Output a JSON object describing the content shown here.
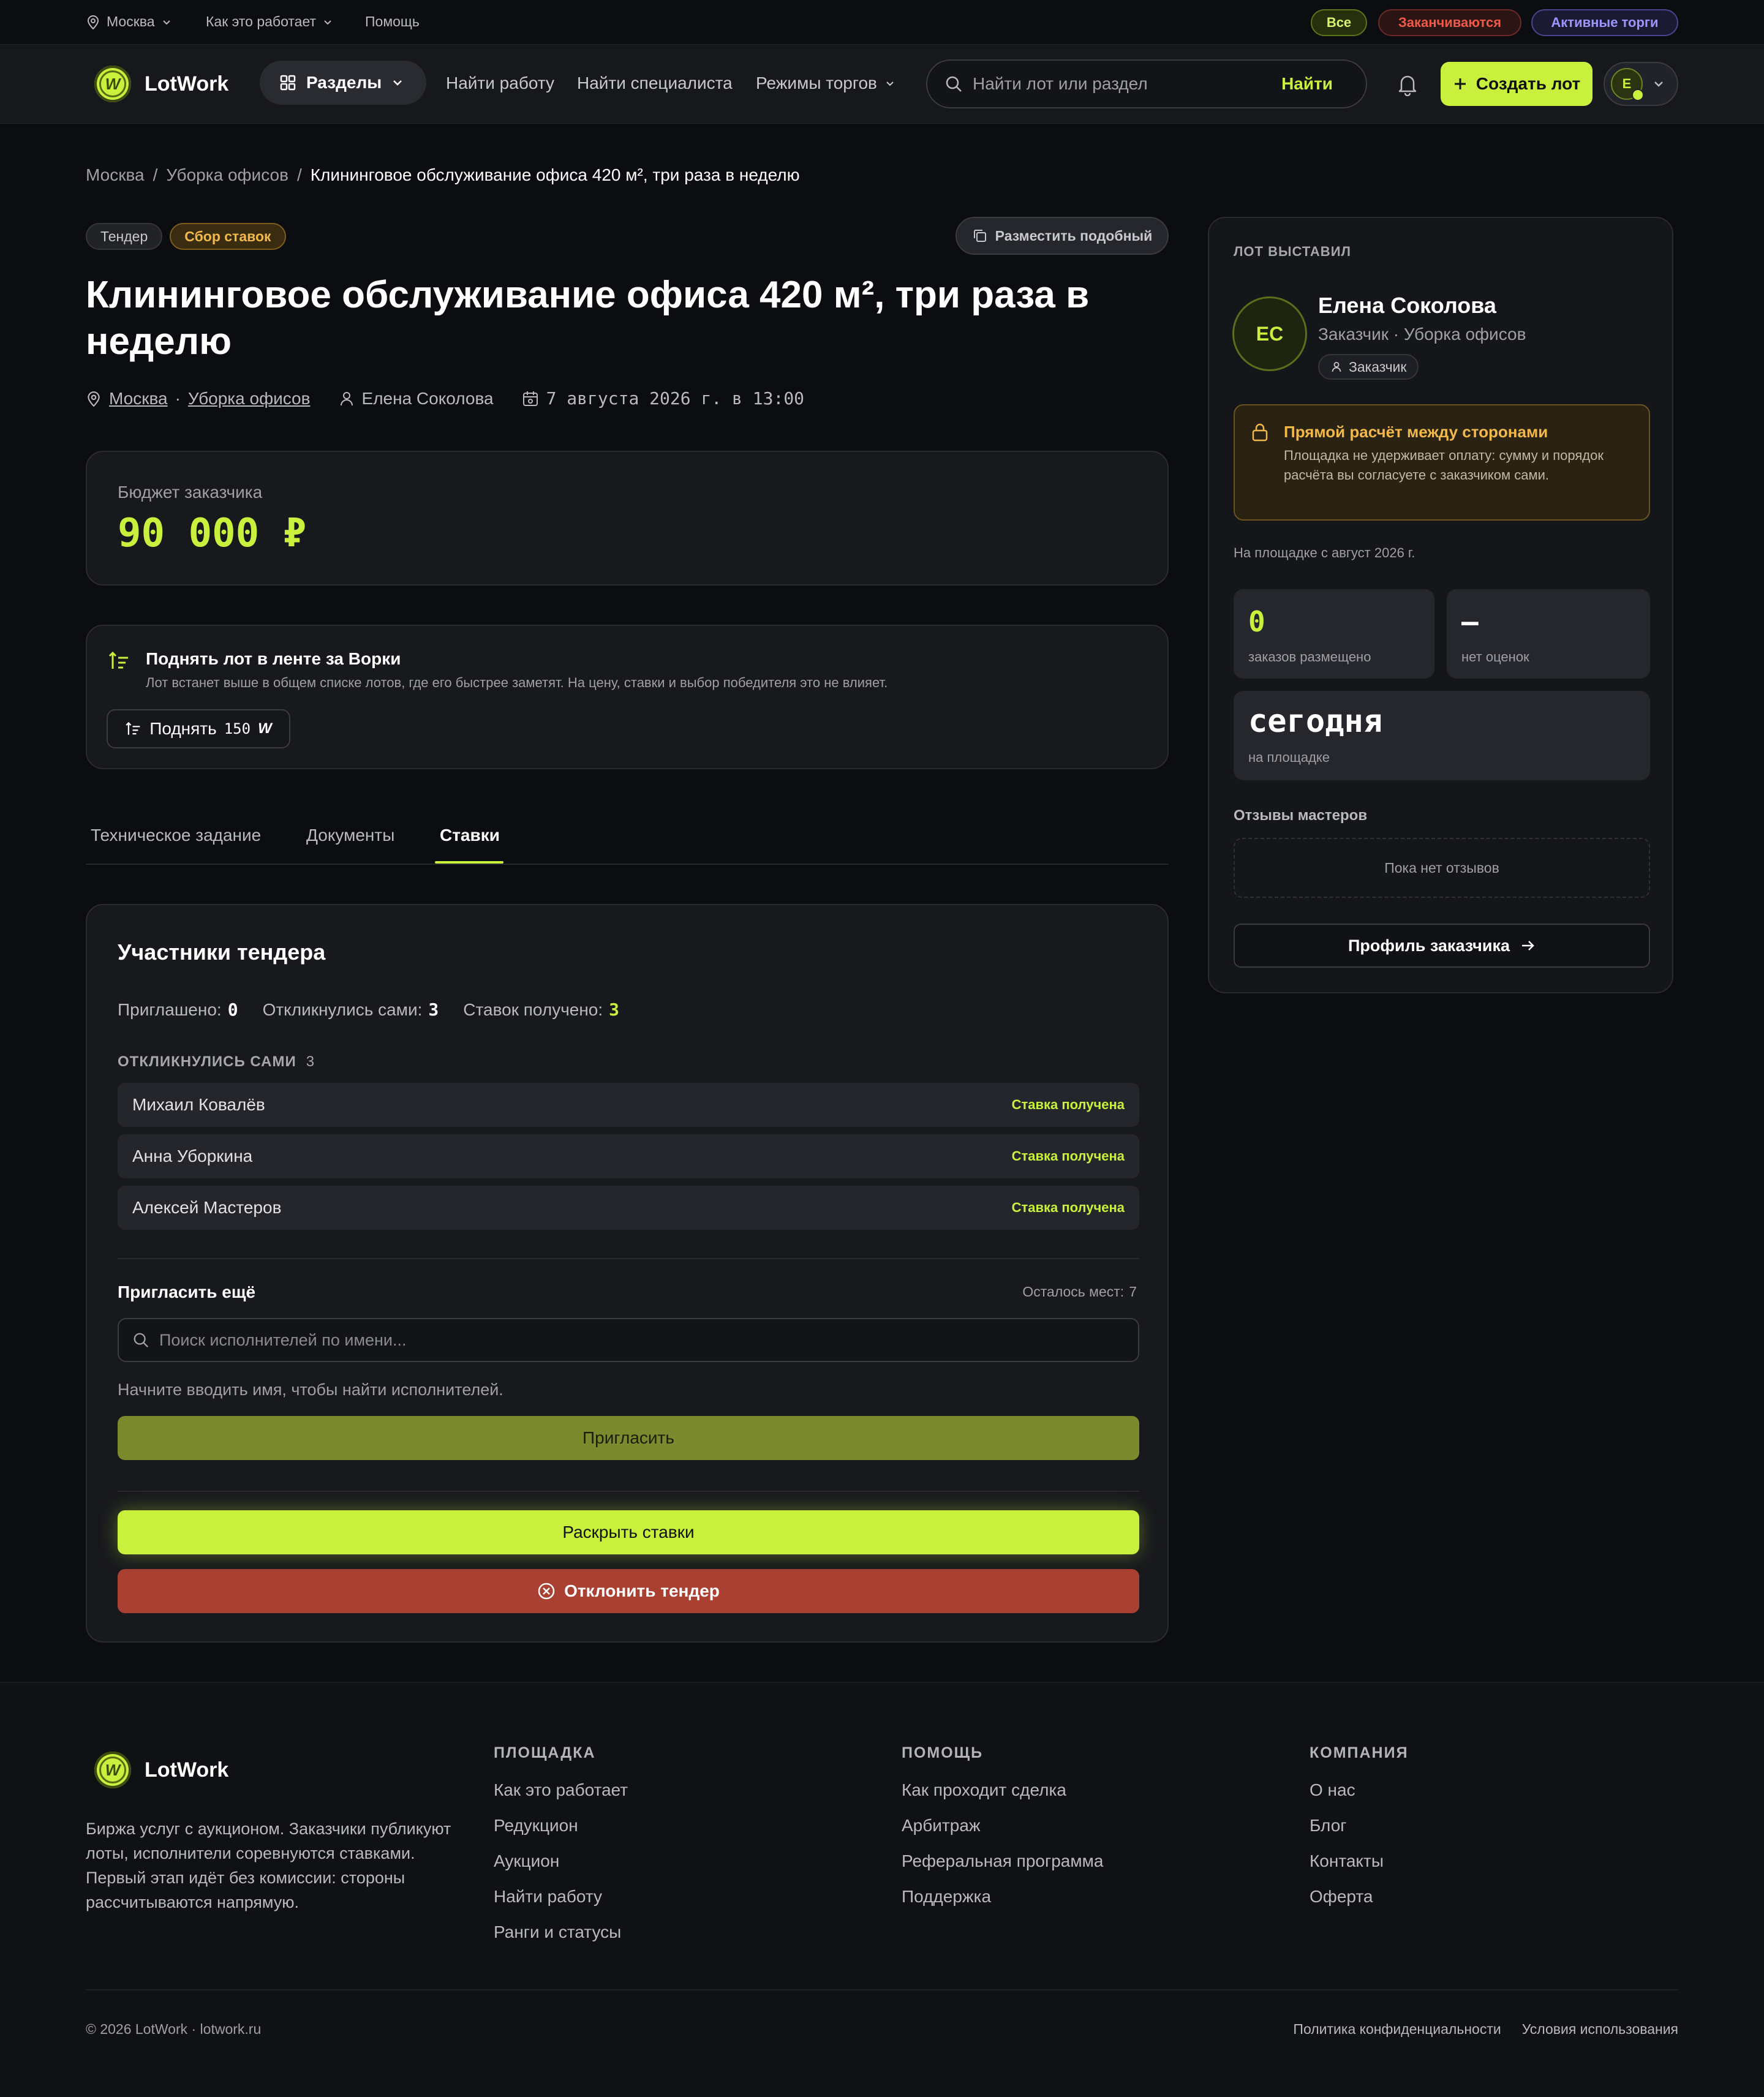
{
  "topbar": {
    "city": "Москва",
    "how": "Как это работает",
    "help": "Помощь",
    "filters": [
      "Все",
      "Заканчиваются",
      "Активные торги"
    ]
  },
  "header": {
    "logo": "LotWork",
    "logo_glyph": "W",
    "sections": "Разделы",
    "nav": [
      "Найти работу",
      "Найти специалиста",
      "Режимы торгов"
    ],
    "search_placeholder": "Найти лот или раздел",
    "search_button": "Найти",
    "create_button": "Создать лот",
    "avatar_letter": "E"
  },
  "breadcrumb": [
    "Москва",
    "Уборка офисов",
    "Клининговое обслуживание офиса 420 м², три раза в неделю"
  ],
  "lot": {
    "tag_type": "Тендер",
    "tag_status": "Сбор ставок",
    "clone_button": "Разместить подобный",
    "title": "Клининговое обслуживание офиса 420 м², три раза в неделю",
    "city": "Москва",
    "category": "Уборка офисов",
    "author": "Елена Соколова",
    "date": "7 августа 2026 г. в 13:00",
    "budget_label": "Бюджет заказчика",
    "budget": "90 000 ₽"
  },
  "boost": {
    "title": "Поднять лот в ленте за Ворки",
    "text": "Лот встанет выше в общем списке лотов, где его быстрее заметят. На цену, ставки и выбор победителя это не влияет.",
    "button": "Поднять",
    "price": "150",
    "currency": "W"
  },
  "tabs": {
    "items": [
      "Техническое задание",
      "Документы",
      "Ставки"
    ],
    "active": "Ставки"
  },
  "participants": {
    "title": "Участники тендера",
    "invited_label": "Приглашено:",
    "invited": "0",
    "responded_label": "Откликнулись сами:",
    "responded": "3",
    "bids_label": "Ставок получено:",
    "bids": "3",
    "section_label": "ОТКЛИКНУЛИСЬ САМИ",
    "section_count": "3",
    "rows": [
      {
        "name": "Михаил Ковалёв",
        "status": "Ставка получена"
      },
      {
        "name": "Анна Уборкина",
        "status": "Ставка получена"
      },
      {
        "name": "Алексей Мастеров",
        "status": "Ставка получена"
      }
    ],
    "invite_title": "Пригласить ещё",
    "slots_label": "Осталось мест:",
    "slots": "7",
    "search_placeholder": "Поиск исполнителей по имени...",
    "hint": "Начните вводить имя, чтобы найти исполнителей.",
    "invite_button": "Пригласить",
    "reveal_button": "Раскрыть ставки",
    "reject_button": "Отклонить тендер"
  },
  "sidebar": {
    "label": "ЛОТ ВЫСТАВИЛ",
    "initials": "ЕС",
    "name": "Елена Соколова",
    "subtitle": "Заказчик · Уборка офисов",
    "role_badge": "Заказчик",
    "notice_title": "Прямой расчёт между сторонами",
    "notice_text": "Площадка не удерживает оплату: сумму и порядок расчёта вы согласуете с заказчиком сами.",
    "since": "На площадке с август 2026 г.",
    "stat1_value": "0",
    "stat1_label": "заказов размещено",
    "stat2_value": "—",
    "stat2_label": "нет оценок",
    "stat3_value": "сегодня",
    "stat3_label": "на площадке",
    "reviews_label": "Отзывы мастеров",
    "reviews_empty": "Пока нет отзывов",
    "profile_button": "Профиль заказчика"
  },
  "footer": {
    "logo": "LotWork",
    "about": "Биржа услуг с аукционом. Заказчики публикуют лоты, исполнители соревнуются ставками. Первый этап идёт без комиссии: стороны рассчитываются напрямую.",
    "cols": [
      {
        "title": "ПЛОЩАДКА",
        "links": [
          "Как это работает",
          "Редукцион",
          "Аукцион",
          "Найти работу",
          "Ранги и статусы"
        ]
      },
      {
        "title": "ПОМОЩЬ",
        "links": [
          "Как проходит сделка",
          "Арбитраж",
          "Реферальная программа",
          "Поддержка"
        ]
      },
      {
        "title": "КОМПАНИЯ",
        "links": [
          "О нас",
          "Блог",
          "Контакты",
          "Оферта"
        ]
      }
    ],
    "copyright": "© 2026 LotWork · lotwork.ru",
    "privacy": "Политика конфиденциальности",
    "terms": "Условия использования"
  },
  "colors": {
    "accent": "#c8f03c",
    "background": "#0c0d10",
    "danger": "#a94032",
    "warning": "#e8a93c"
  }
}
